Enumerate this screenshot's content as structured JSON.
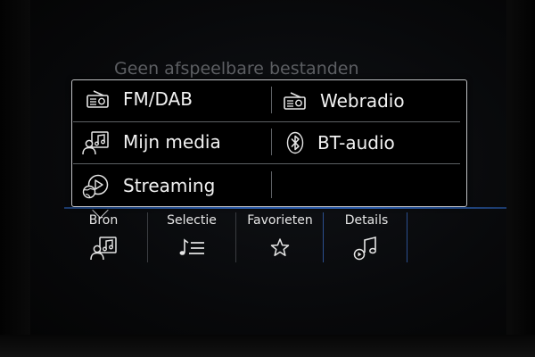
{
  "status": {
    "message": "Geen afspeelbare bestanden"
  },
  "source_menu": {
    "items": [
      {
        "label": "FM/DAB",
        "icon": "radio-icon"
      },
      {
        "label": "Webradio",
        "icon": "radio-icon"
      },
      {
        "label": "Mijn media",
        "icon": "my-media-icon"
      },
      {
        "label": "BT-audio",
        "icon": "bluetooth-icon"
      },
      {
        "label": "Streaming",
        "icon": "streaming-icon"
      }
    ]
  },
  "bottom_nav": {
    "tabs": [
      {
        "label": "Bron",
        "icon": "my-media-icon"
      },
      {
        "label": "Selectie",
        "icon": "playlist-icon"
      },
      {
        "label": "Favorieten",
        "icon": "star-icon"
      },
      {
        "label": "Details",
        "icon": "music-note-icon"
      }
    ]
  },
  "colors": {
    "accent_line": "#2b5aa8",
    "popup_border": "#bfc1c4"
  }
}
